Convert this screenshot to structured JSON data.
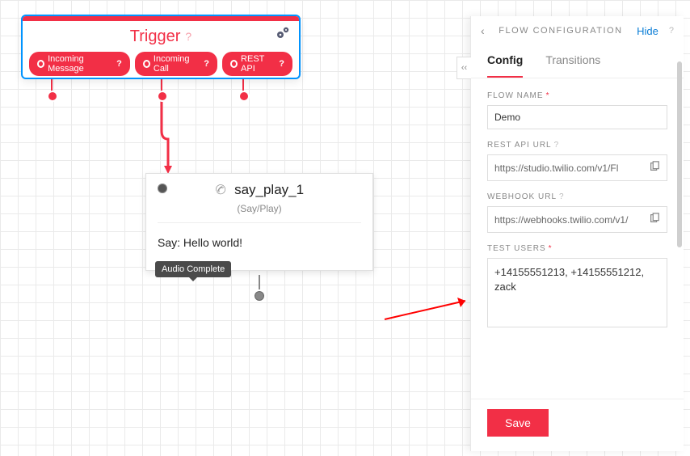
{
  "trigger": {
    "title": "Trigger",
    "tags": [
      "Incoming Message",
      "Incoming Call",
      "REST API"
    ]
  },
  "sayplay": {
    "name": "say_play_1",
    "subtypeLabel": "(Say/Play)",
    "bodyText": "Say: Hello world!",
    "outTooltip": "Audio Complete"
  },
  "panel": {
    "header": {
      "title": "FLOW CONFIGURATION",
      "hideLabel": "Hide"
    },
    "tabs": {
      "config": "Config",
      "transitions": "Transitions",
      "active": "config"
    },
    "fields": {
      "flowNameLabel": "FLOW NAME",
      "flowNameValue": "Demo",
      "restApiLabel": "REST API URL",
      "restApiValue": "https://studio.twilio.com/v1/Fl",
      "webhookLabel": "WEBHOOK URL",
      "webhookValue": "https://webhooks.twilio.com/v1/",
      "testUsersLabel": "TEST USERS",
      "testUsersValue": "+14155551213, +14155551212, zack"
    },
    "saveLabel": "Save"
  }
}
